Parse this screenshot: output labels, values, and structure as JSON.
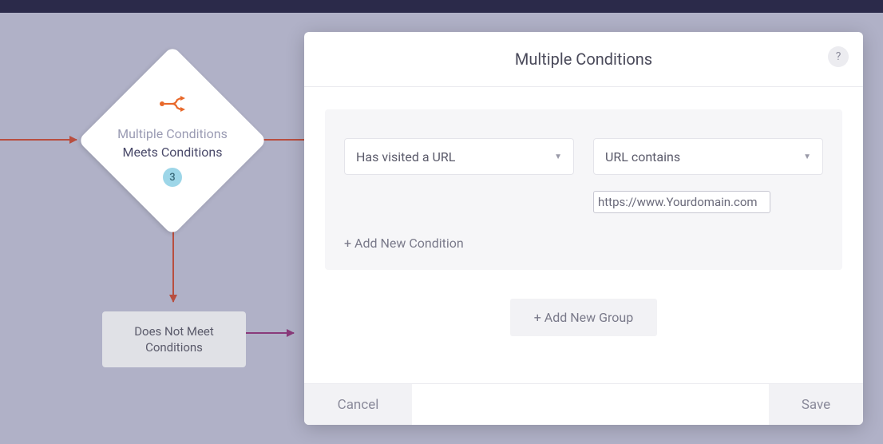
{
  "canvas": {
    "diamond": {
      "title": "Multiple Conditions",
      "subtitle": "Meets Conditions",
      "badge": "3"
    },
    "not_meet_box": "Does Not Meet Conditions"
  },
  "modal": {
    "title": "Multiple Conditions",
    "help": "?",
    "condition": {
      "field": "Has visited a URL",
      "operator": "URL contains",
      "value": "https://www.Yourdomain.com"
    },
    "add_condition": "+ Add New Condition",
    "add_group": "+ Add New Group",
    "cancel": "Cancel",
    "save": "Save"
  }
}
